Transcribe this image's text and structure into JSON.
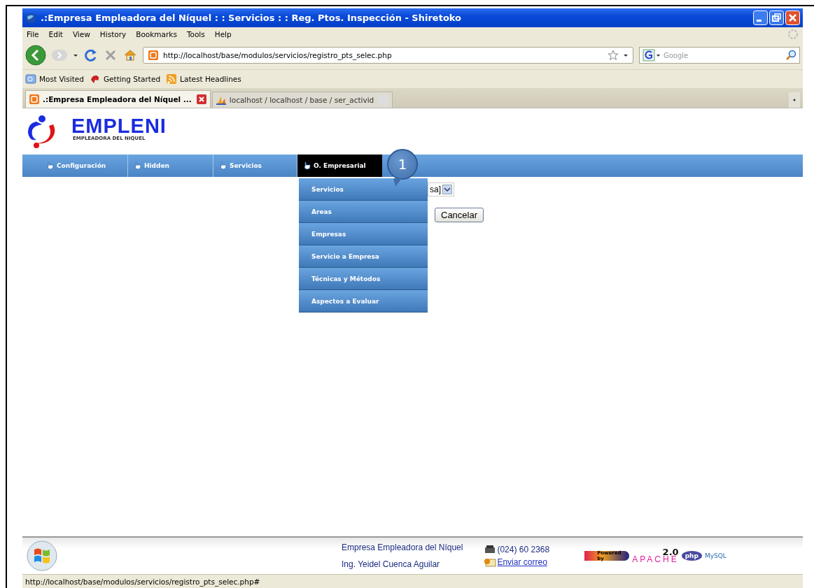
{
  "window": {
    "title": ".:Empresa Empleadora del Níquel : : Servicios : : Reg. Ptos. Inspección - Shiretoko"
  },
  "menu_bar": [
    "File",
    "Edit",
    "View",
    "History",
    "Bookmarks",
    "Tools",
    "Help"
  ],
  "address_bar": {
    "url": "http://localhost/base/modulos/servicios/registro_pts_selec.php"
  },
  "search": {
    "placeholder": "Google"
  },
  "bookmarks": [
    "Most Visited",
    "Getting Started",
    "Latest Headlines"
  ],
  "tabs": [
    {
      "label": ".:Empresa Empleadora del Níquel ...",
      "selected": true
    },
    {
      "label": "localhost / localhost / base / ser_activid",
      "selected": false
    }
  ],
  "site": {
    "logo": {
      "name": "EMPLENI",
      "tagline": "EMPLEADORA DEL NIQUEL"
    },
    "nav": [
      {
        "label": "Configuración",
        "selected": false
      },
      {
        "label": "Hidden",
        "selected": false
      },
      {
        "label": "Servicios",
        "selected": false
      },
      {
        "label": "O. Empresarial",
        "selected": true
      }
    ],
    "dropdown": [
      "Servicios",
      "Areas",
      "Empresas",
      "Servicio a Empresa",
      "Técnicas y Métodos",
      "Aspectos a Evaluar"
    ],
    "callout": "1",
    "select": {
      "value": "sa]"
    },
    "buttons": [
      "Cancelar"
    ]
  },
  "footer": {
    "company": "Empresa Empleadora del Níquel",
    "author": "Ing. Yeidel Cuenca Aguilar",
    "phone": "(024) 60 2368",
    "email_link": "Enviar correo",
    "powered": [
      "Powered by",
      "APACHE",
      "2.0",
      "php",
      "MySQL"
    ]
  },
  "status_bar": "http://localhost/base/modulos/servicios/registro_pts_selec.php#"
}
